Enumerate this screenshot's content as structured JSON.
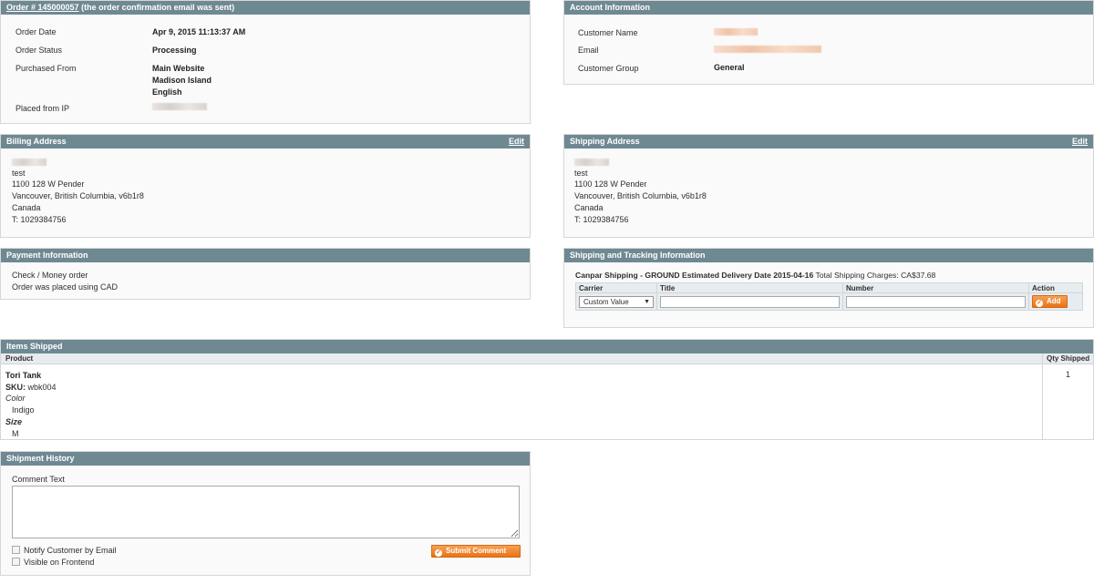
{
  "order": {
    "title_link": "Order # 145000057",
    "title_note": " (the order confirmation email was sent)",
    "rows": [
      {
        "label": "Order Date",
        "value": "Apr 9, 2015 11:13:37 AM"
      },
      {
        "label": "Order Status",
        "value": "Processing"
      },
      {
        "label": "Purchased From",
        "value_lines": [
          "Main Website",
          "Madison Island",
          "English"
        ]
      }
    ],
    "ip_label": "Placed from IP"
  },
  "account": {
    "title": "Account Information",
    "name_label": "Customer Name",
    "email_label": "Email",
    "group_label": "Customer Group",
    "group_value": "General"
  },
  "billing": {
    "title": "Billing Address",
    "edit": "Edit",
    "lines": [
      "test",
      "1100 128 W Pender",
      "Vancouver, British Columbia, v6b1r8",
      "Canada",
      "T: 1029384756"
    ]
  },
  "shipping_address": {
    "title": "Shipping Address",
    "edit": "Edit",
    "lines": [
      "test",
      "1100 128 W Pender",
      "Vancouver, British Columbia, v6b1r8",
      "Canada",
      "T: 1029384756"
    ]
  },
  "payment": {
    "title": "Payment Information",
    "lines": [
      "Check / Money order",
      "Order was placed using CAD"
    ]
  },
  "tracking": {
    "title": "Shipping and Tracking Information",
    "method_bold": "Canpar Shipping - GROUND Estimated Delivery Date 2015-04-16",
    "charges": " Total Shipping Charges: CA$37.68",
    "columns": [
      "Carrier",
      "Title",
      "Number",
      "Action"
    ],
    "carrier_selected": "Custom Value",
    "add_label": "Add"
  },
  "items": {
    "title": "Items Shipped",
    "col_product": "Product",
    "col_qty": "Qty Shipped",
    "product_name": "Tori Tank",
    "sku": "SKU: wbk004",
    "color_label": "Color",
    "color_value": "Indigo",
    "size_label": "Size",
    "size_value": "M",
    "qty": "1"
  },
  "history": {
    "title": "Shipment History",
    "comment_label": "Comment Text",
    "notify_label": "Notify Customer by Email",
    "visible_label": "Visible on Frontend",
    "submit_label": "Submit Comment"
  }
}
